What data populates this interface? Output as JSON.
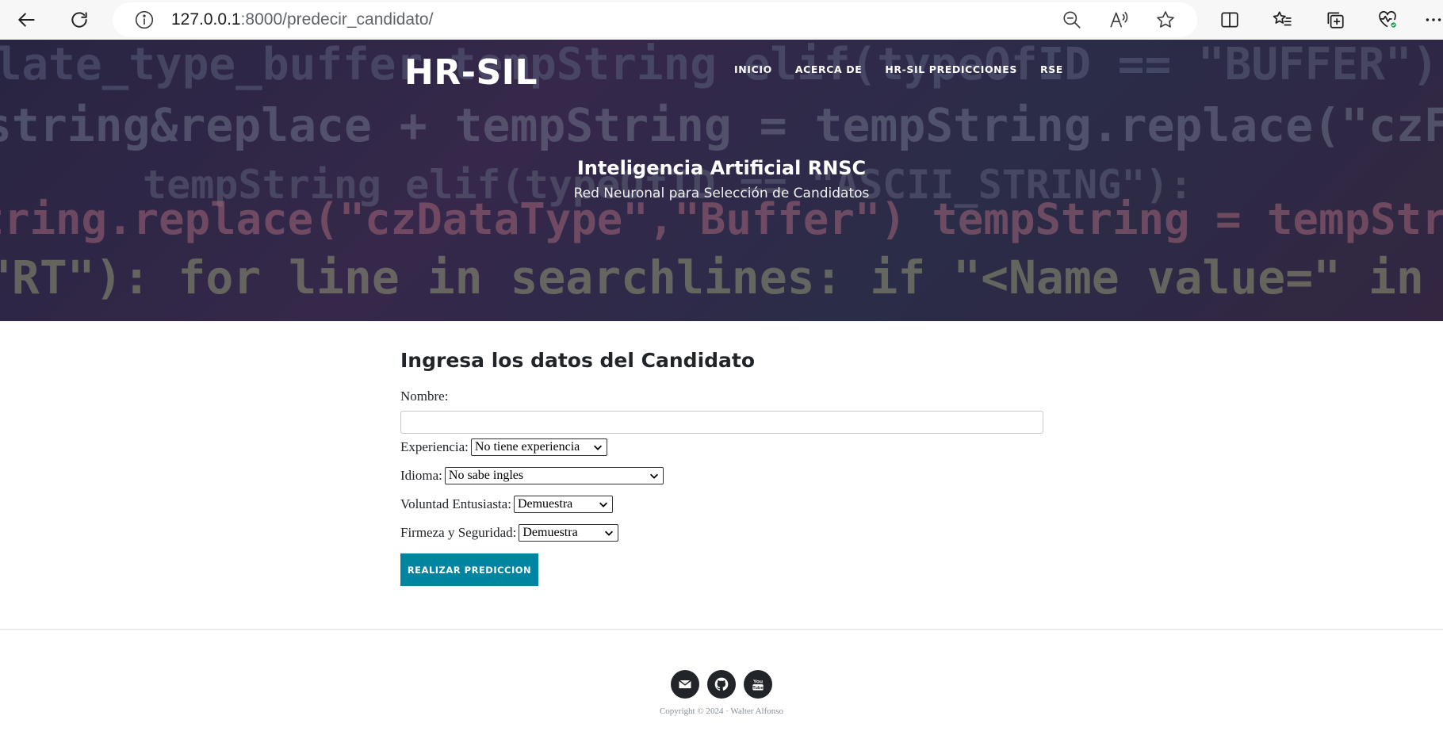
{
  "browser": {
    "url_host": "127.0.0.1",
    "url_rest": ":8000/predecir_candidato/"
  },
  "site": {
    "brand": "HR-SIL",
    "nav": [
      {
        "label": "INICIO"
      },
      {
        "label": "ACERCA DE"
      },
      {
        "label": "HR-SIL PREDICCIONES"
      },
      {
        "label": "RSE"
      }
    ]
  },
  "hero": {
    "title": "Inteligencia Artificial RNSC",
    "subtitle": "Red Neuronal para Selección de Candidatos",
    "background_code": [
      "plate_type_buffer tempString elif(typeOfID == \"BUFFER\"):",
      "string&replace + tempString = tempString.replace(\"czFieldID\",",
      "tempString elif(typeOfID == \"ASCII_STRING\"):",
      "String.replace(\"czDataType\",\"Buffer\") tempString = tempString.replace",
      "\"RT\"): for line in searchlines: if \"<Name value=\" in line and"
    ]
  },
  "form": {
    "heading": "Ingresa los datos del Candidato",
    "nombre_label": "Nombre:",
    "nombre_value": "",
    "experiencia_label": "Experiencia:",
    "experiencia_value": "No tiene experiencia",
    "idioma_label": "Idioma:",
    "idioma_value": "No sabe ingles",
    "voluntad_label": "Voluntad Entusiasta:",
    "voluntad_value": "Demuestra",
    "firmeza_label": "Firmeza y Seguridad:",
    "firmeza_value": "Demuestra",
    "submit_label": "REALIZAR PREDICCION"
  },
  "footer": {
    "social_icons": [
      "envelope-icon",
      "github-icon",
      "youtube-icon"
    ],
    "youtube_glyph": "You\nTube",
    "copyright": "Copyright © 2024 · Walter Alfonso"
  },
  "colors": {
    "accent": "#0085a1",
    "text": "#212529",
    "hero_bg": "#2f2c4c"
  }
}
